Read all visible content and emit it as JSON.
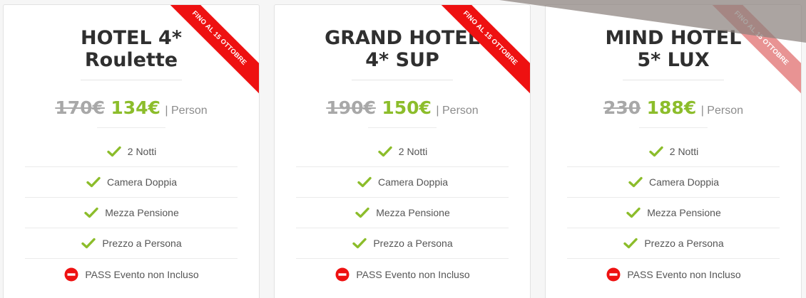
{
  "colors": {
    "accent_green": "#8cbd2b",
    "ribbon_red": "#ee1111",
    "exclude_red": "#ee1111"
  },
  "cards": [
    {
      "title_line1": "HOTEL 4*",
      "title_line2": "Roulette",
      "ribbon": "FINO AL 15 OTTOBRE",
      "old_price": "170€",
      "new_price": "134€",
      "unit": "| Person",
      "features": [
        {
          "text": "2 Notti",
          "icon": "check-icon"
        },
        {
          "text": "Camera Doppia",
          "icon": "check-icon"
        },
        {
          "text": "Mezza Pensione",
          "icon": "check-icon"
        },
        {
          "text": "Prezzo a Persona",
          "icon": "check-icon"
        },
        {
          "text": "PASS Evento non Incluso",
          "icon": "minus-circle-icon"
        }
      ]
    },
    {
      "title_line1": "GRAND HOTEL",
      "title_line2": "4* SUP",
      "ribbon": "FINO AL 15 OTTOBRE",
      "old_price": "190€",
      "new_price": "150€",
      "unit": "| Person",
      "features": [
        {
          "text": "2 Notti",
          "icon": "check-icon"
        },
        {
          "text": "Camera Doppia",
          "icon": "check-icon"
        },
        {
          "text": "Mezza Pensione",
          "icon": "check-icon"
        },
        {
          "text": "Prezzo a Persona",
          "icon": "check-icon"
        },
        {
          "text": "PASS Evento non Incluso",
          "icon": "minus-circle-icon"
        }
      ]
    },
    {
      "title_line1": "MIND HOTEL",
      "title_line2": "5* LUX",
      "ribbon": "FINO AL 15 OTTOBRE",
      "old_price": "230",
      "new_price": "188€",
      "unit": "| Person",
      "features": [
        {
          "text": "2 Notti",
          "icon": "check-icon"
        },
        {
          "text": "Camera Doppia",
          "icon": "check-icon"
        },
        {
          "text": "Mezza Pensione",
          "icon": "check-icon"
        },
        {
          "text": "Prezzo a Persona",
          "icon": "check-icon"
        },
        {
          "text": "PASS Evento non Incluso",
          "icon": "minus-circle-icon"
        }
      ]
    }
  ]
}
